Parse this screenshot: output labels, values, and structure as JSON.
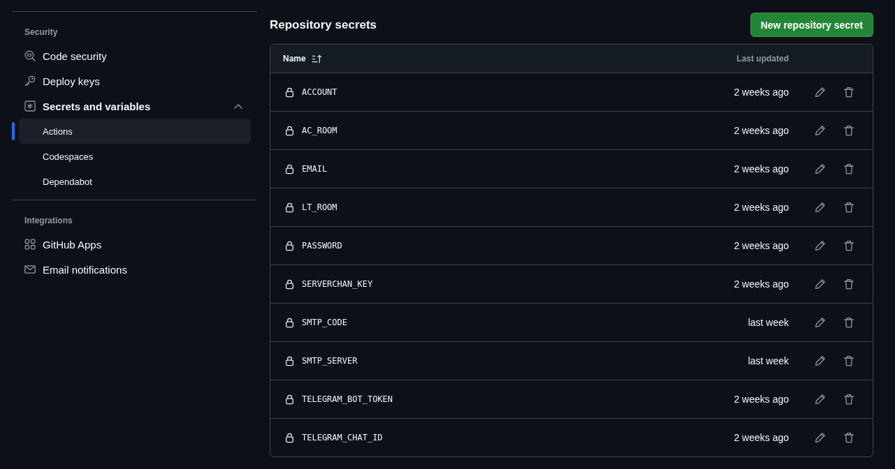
{
  "sidebar": {
    "sections": [
      {
        "heading": "Security",
        "items": [
          {
            "label": "Code security",
            "selected": false
          },
          {
            "label": "Deploy keys",
            "selected": false
          },
          {
            "label": "Secrets and variables",
            "selected": false,
            "expanded": true,
            "children": [
              {
                "label": "Actions",
                "selected": true
              },
              {
                "label": "Codespaces",
                "selected": false
              },
              {
                "label": "Dependabot",
                "selected": false
              }
            ]
          }
        ]
      },
      {
        "heading": "Integrations",
        "items": [
          {
            "label": "GitHub Apps",
            "selected": false
          },
          {
            "label": "Email notifications",
            "selected": false
          }
        ]
      }
    ]
  },
  "main": {
    "title": "Repository secrets",
    "new_button": "New repository secret",
    "table": {
      "columns": [
        "Name",
        "Last updated"
      ],
      "rows": [
        {
          "name": "ACCOUNT",
          "updated": "2 weeks ago"
        },
        {
          "name": "AC_ROOM",
          "updated": "2 weeks ago"
        },
        {
          "name": "EMAIL",
          "updated": "2 weeks ago"
        },
        {
          "name": "LT_ROOM",
          "updated": "2 weeks ago"
        },
        {
          "name": "PASSWORD",
          "updated": "2 weeks ago"
        },
        {
          "name": "SERVERCHAN_KEY",
          "updated": "2 weeks ago"
        },
        {
          "name": "SMTP_CODE",
          "updated": "last week"
        },
        {
          "name": "SMTP_SERVER",
          "updated": "last week"
        },
        {
          "name": "TELEGRAM_BOT_TOKEN",
          "updated": "2 weeks ago"
        },
        {
          "name": "TELEGRAM_CHAT_ID",
          "updated": "2 weeks ago"
        }
      ]
    }
  }
}
